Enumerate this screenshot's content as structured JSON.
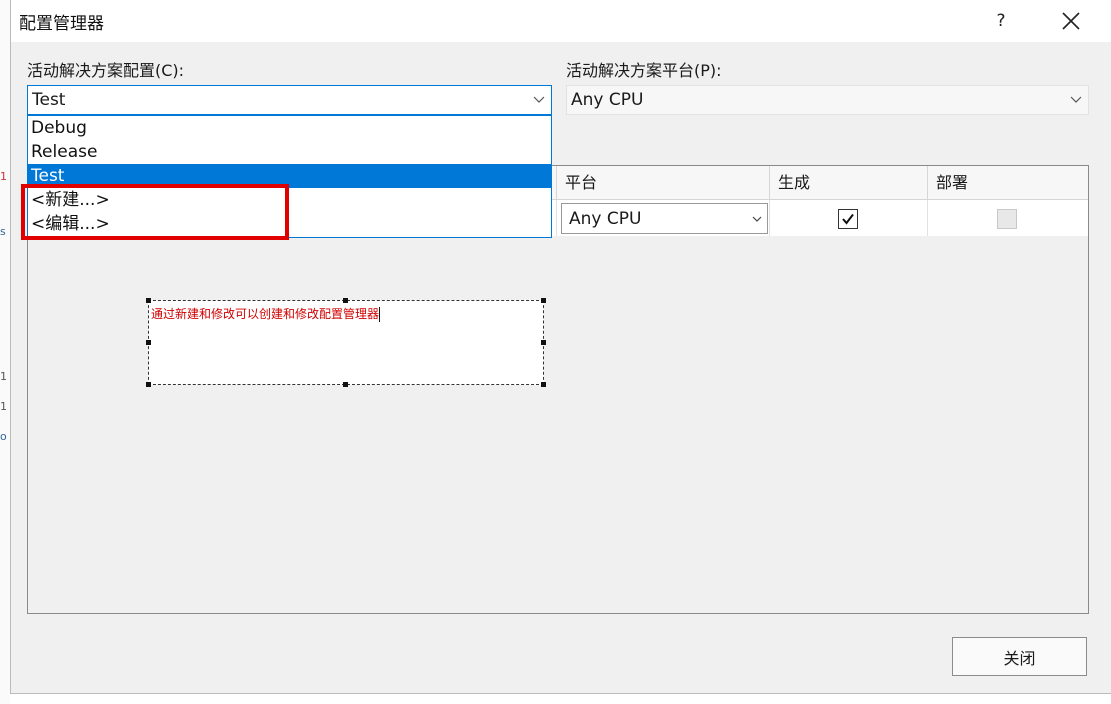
{
  "window": {
    "title": "配置管理器",
    "help_label": "?"
  },
  "solution_config": {
    "label": "活动解决方案配置(C):",
    "selected": "Test",
    "options": [
      "Debug",
      "Release",
      "Test",
      "<新建...>",
      "<编辑...>"
    ]
  },
  "solution_platform": {
    "label": "活动解决方案平台(P):",
    "selected": "Any CPU"
  },
  "grid": {
    "columns": {
      "platform": "平台",
      "build": "生成",
      "deploy": "部署"
    },
    "row": {
      "platform": "Any CPU",
      "build_checked": true,
      "deploy_checked": false
    }
  },
  "annotation": {
    "text": "通过新建和修改可以创建和修改配置管理器",
    "color": "#d00000"
  },
  "footer": {
    "close_label": "关闭"
  },
  "colors": {
    "accent": "#0078d7",
    "highlight_box": "#e00000"
  }
}
